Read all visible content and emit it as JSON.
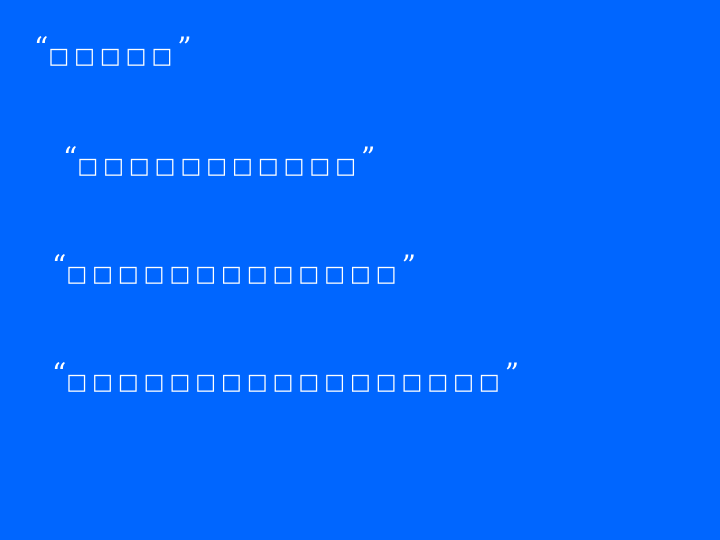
{
  "slide": {
    "background_color": "#0066ff",
    "text_color": "#ffffff",
    "open_quote": "“",
    "close_quote": "”",
    "lines": [
      {
        "text": "□□□□□"
      },
      {
        "text": "□□□□□□□□□□□"
      },
      {
        "text": "□□□□□□□□□□□□□"
      },
      {
        "text": "□□□□□□□□□□□□□□□□□"
      }
    ]
  }
}
